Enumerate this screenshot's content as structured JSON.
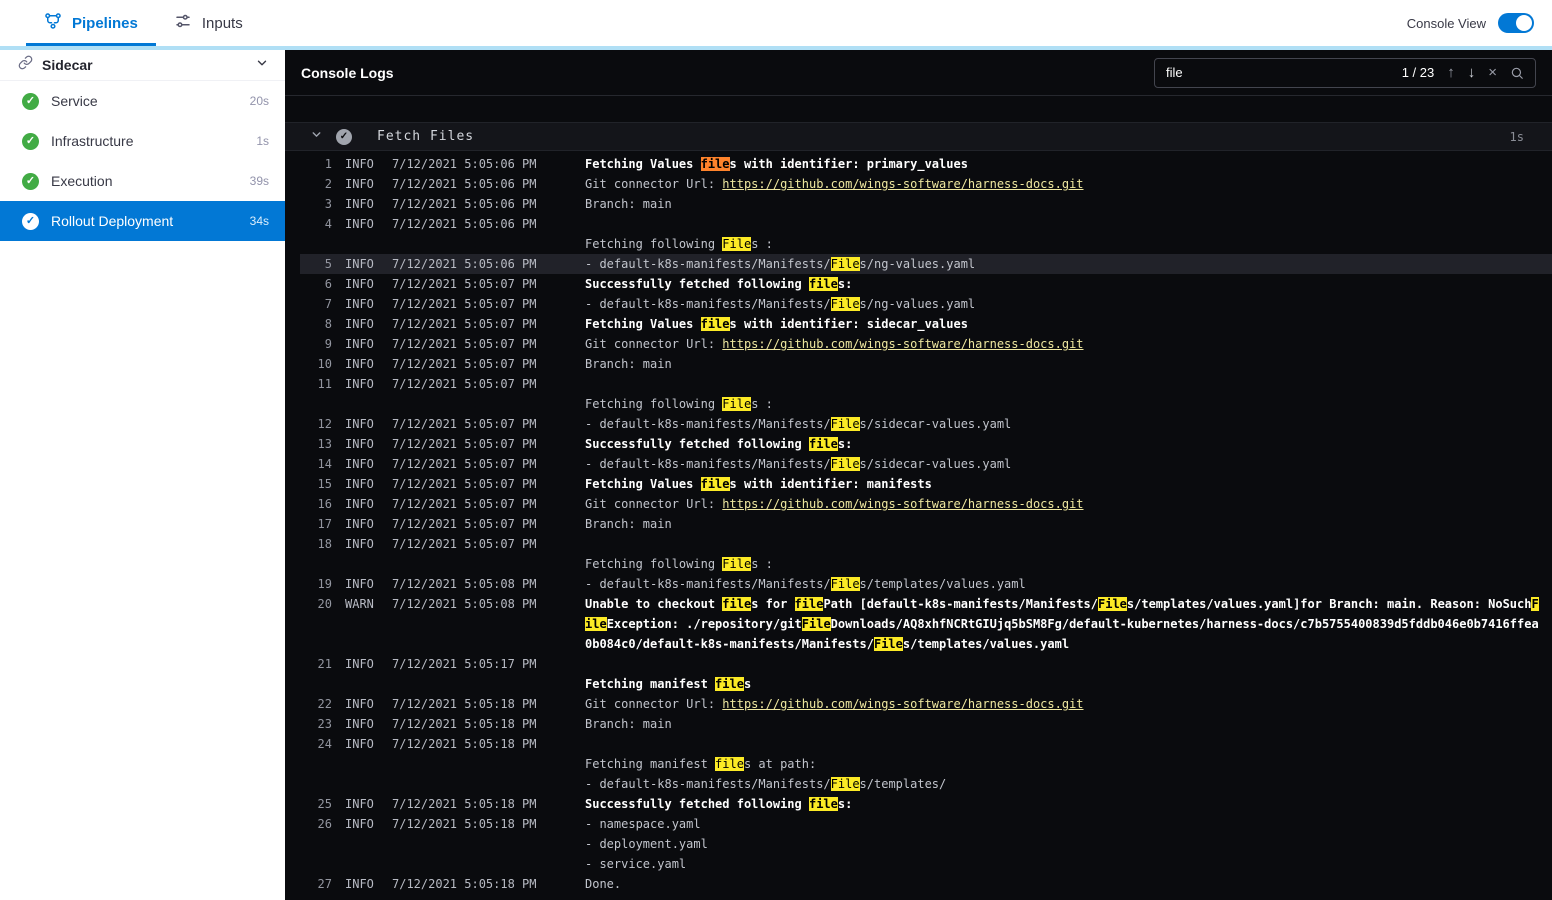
{
  "topbar": {
    "tabs": [
      {
        "label": "Pipelines"
      },
      {
        "label": "Inputs"
      }
    ],
    "console_view": {
      "label": "Console View",
      "on": true
    }
  },
  "sidebar": {
    "title": "Sidecar",
    "items": [
      {
        "label": "Service",
        "duration": "20s",
        "status": "success",
        "selected": false
      },
      {
        "label": "Infrastructure",
        "duration": "1s",
        "status": "success",
        "selected": false
      },
      {
        "label": "Execution",
        "duration": "39s",
        "status": "success",
        "selected": false
      },
      {
        "label": "Rollout Deployment",
        "duration": "34s",
        "status": "success",
        "selected": true
      }
    ]
  },
  "console": {
    "title": "Console Logs",
    "search": {
      "value": "file",
      "count": "1 / 23"
    },
    "section": {
      "title": "Fetch Files",
      "duration": "1s"
    },
    "colors": {
      "accent": "#0278d5",
      "highlight": "#fcea25",
      "current_match": "#ff832b",
      "success": "#42ab45",
      "topbar_divider": "#b0dff5"
    },
    "logs": [
      {
        "n": "1",
        "lvl": "INFO",
        "t": "7/12/2021 5:05:06 PM",
        "lines": [
          {
            "b": 1,
            "seg": [
              [
                "Fetching Values ",
                ""
              ],
              [
                "file",
                "c"
              ],
              [
                "s with identifier: primary_values",
                ""
              ]
            ]
          }
        ]
      },
      {
        "n": "2",
        "lvl": "INFO",
        "t": "7/12/2021 5:05:06 PM",
        "lines": [
          {
            "seg": [
              [
                "Git connector Url: ",
                ""
              ],
              [
                "https://github.com/wings-software/harness-docs.git",
                "u"
              ]
            ]
          }
        ]
      },
      {
        "n": "3",
        "lvl": "INFO",
        "t": "7/12/2021 5:05:06 PM",
        "lines": [
          {
            "seg": [
              [
                "Branch: main",
                ""
              ]
            ]
          }
        ]
      },
      {
        "n": "4",
        "lvl": "INFO",
        "t": "7/12/2021 5:05:06 PM",
        "lines": [
          {
            "seg": [
              [
                "",
                ""
              ]
            ]
          },
          {
            "seg": [
              [
                "Fetching following ",
                ""
              ],
              [
                "File",
                "h"
              ],
              [
                "s :",
                ""
              ]
            ]
          }
        ]
      },
      {
        "n": "5",
        "lvl": "INFO",
        "t": "7/12/2021 5:05:06 PM",
        "hl": 1,
        "lines": [
          {
            "seg": [
              [
                "- default-k8s-manifests/Manifests/",
                ""
              ],
              [
                "File",
                "h"
              ],
              [
                "s/ng-values.yaml",
                ""
              ]
            ]
          }
        ]
      },
      {
        "n": "6",
        "lvl": "INFO",
        "t": "7/12/2021 5:05:07 PM",
        "lines": [
          {
            "b": 1,
            "seg": [
              [
                "Successfully fetched following ",
                ""
              ],
              [
                "file",
                "h"
              ],
              [
                "s:",
                ""
              ]
            ]
          }
        ]
      },
      {
        "n": "7",
        "lvl": "INFO",
        "t": "7/12/2021 5:05:07 PM",
        "lines": [
          {
            "seg": [
              [
                "- default-k8s-manifests/Manifests/",
                ""
              ],
              [
                "File",
                "h"
              ],
              [
                "s/ng-values.yaml",
                ""
              ]
            ]
          }
        ]
      },
      {
        "n": "8",
        "lvl": "INFO",
        "t": "7/12/2021 5:05:07 PM",
        "lines": [
          {
            "b": 1,
            "seg": [
              [
                "Fetching Values ",
                ""
              ],
              [
                "file",
                "h"
              ],
              [
                "s with identifier: sidecar_values",
                ""
              ]
            ]
          }
        ]
      },
      {
        "n": "9",
        "lvl": "INFO",
        "t": "7/12/2021 5:05:07 PM",
        "lines": [
          {
            "seg": [
              [
                "Git connector Url: ",
                ""
              ],
              [
                "https://github.com/wings-software/harness-docs.git",
                "u"
              ]
            ]
          }
        ]
      },
      {
        "n": "10",
        "lvl": "INFO",
        "t": "7/12/2021 5:05:07 PM",
        "lines": [
          {
            "seg": [
              [
                "Branch: main",
                ""
              ]
            ]
          }
        ]
      },
      {
        "n": "11",
        "lvl": "INFO",
        "t": "7/12/2021 5:05:07 PM",
        "lines": [
          {
            "seg": [
              [
                "",
                ""
              ]
            ]
          },
          {
            "seg": [
              [
                "Fetching following ",
                ""
              ],
              [
                "File",
                "h"
              ],
              [
                "s :",
                ""
              ]
            ]
          }
        ]
      },
      {
        "n": "12",
        "lvl": "INFO",
        "t": "7/12/2021 5:05:07 PM",
        "lines": [
          {
            "seg": [
              [
                "- default-k8s-manifests/Manifests/",
                ""
              ],
              [
                "File",
                "h"
              ],
              [
                "s/sidecar-values.yaml",
                ""
              ]
            ]
          }
        ]
      },
      {
        "n": "13",
        "lvl": "INFO",
        "t": "7/12/2021 5:05:07 PM",
        "lines": [
          {
            "b": 1,
            "seg": [
              [
                "Successfully fetched following ",
                ""
              ],
              [
                "file",
                "h"
              ],
              [
                "s:",
                ""
              ]
            ]
          }
        ]
      },
      {
        "n": "14",
        "lvl": "INFO",
        "t": "7/12/2021 5:05:07 PM",
        "lines": [
          {
            "seg": [
              [
                "- default-k8s-manifests/Manifests/",
                ""
              ],
              [
                "File",
                "h"
              ],
              [
                "s/sidecar-values.yaml",
                ""
              ]
            ]
          }
        ]
      },
      {
        "n": "15",
        "lvl": "INFO",
        "t": "7/12/2021 5:05:07 PM",
        "lines": [
          {
            "b": 1,
            "seg": [
              [
                "Fetching Values ",
                ""
              ],
              [
                "file",
                "h"
              ],
              [
                "s with identifier: manifests",
                ""
              ]
            ]
          }
        ]
      },
      {
        "n": "16",
        "lvl": "INFO",
        "t": "7/12/2021 5:05:07 PM",
        "lines": [
          {
            "seg": [
              [
                "Git connector Url: ",
                ""
              ],
              [
                "https://github.com/wings-software/harness-docs.git",
                "u"
              ]
            ]
          }
        ]
      },
      {
        "n": "17",
        "lvl": "INFO",
        "t": "7/12/2021 5:05:07 PM",
        "lines": [
          {
            "seg": [
              [
                "Branch: main",
                ""
              ]
            ]
          }
        ]
      },
      {
        "n": "18",
        "lvl": "INFO",
        "t": "7/12/2021 5:05:07 PM",
        "lines": [
          {
            "seg": [
              [
                "",
                ""
              ]
            ]
          },
          {
            "seg": [
              [
                "Fetching following ",
                ""
              ],
              [
                "File",
                "h"
              ],
              [
                "s :",
                ""
              ]
            ]
          }
        ]
      },
      {
        "n": "19",
        "lvl": "INFO",
        "t": "7/12/2021 5:05:08 PM",
        "lines": [
          {
            "seg": [
              [
                "- default-k8s-manifests/Manifests/",
                ""
              ],
              [
                "File",
                "h"
              ],
              [
                "s/templates/values.yaml",
                ""
              ]
            ]
          }
        ]
      },
      {
        "n": "20",
        "lvl": "WARN",
        "t": "7/12/2021 5:05:08 PM",
        "lines": [
          {
            "b": 1,
            "seg": [
              [
                "Unable to checkout ",
                ""
              ],
              [
                "file",
                "h"
              ],
              [
                "s for ",
                ""
              ],
              [
                "file",
                "h"
              ],
              [
                "Path [default-k8s-manifests/Manifests/",
                ""
              ],
              [
                "File",
                "h"
              ],
              [
                "s/templates/values.yaml]for Branch: main. Reason: NoSuch",
                ""
              ],
              [
                "F",
                "h"
              ]
            ]
          },
          {
            "b": 1,
            "seg": [
              [
                "ile",
                "h"
              ],
              [
                "Exception: ./repository/git",
                ""
              ],
              [
                "File",
                "h"
              ],
              [
                "Downloads/AQ8xhfNCRtGIUjq5bSM8Fg/default-kubernetes/harness-docs/c7b5755400839d5fddb046e0b7416ffea",
                ""
              ]
            ]
          },
          {
            "b": 1,
            "seg": [
              [
                "0b084c0/default-k8s-manifests/Manifests/",
                ""
              ],
              [
                "File",
                "h"
              ],
              [
                "s/templates/values.yaml",
                ""
              ]
            ]
          }
        ]
      },
      {
        "n": "21",
        "lvl": "INFO",
        "t": "7/12/2021 5:05:17 PM",
        "lines": [
          {
            "seg": [
              [
                "",
                ""
              ]
            ]
          },
          {
            "b": 1,
            "seg": [
              [
                "Fetching manifest ",
                ""
              ],
              [
                "file",
                "h"
              ],
              [
                "s",
                ""
              ]
            ]
          }
        ]
      },
      {
        "n": "22",
        "lvl": "INFO",
        "t": "7/12/2021 5:05:18 PM",
        "lines": [
          {
            "seg": [
              [
                "Git connector Url: ",
                ""
              ],
              [
                "https://github.com/wings-software/harness-docs.git",
                "u"
              ]
            ]
          }
        ]
      },
      {
        "n": "23",
        "lvl": "INFO",
        "t": "7/12/2021 5:05:18 PM",
        "lines": [
          {
            "seg": [
              [
                "Branch: main",
                ""
              ]
            ]
          }
        ]
      },
      {
        "n": "24",
        "lvl": "INFO",
        "t": "7/12/2021 5:05:18 PM",
        "lines": [
          {
            "seg": [
              [
                "",
                ""
              ]
            ]
          },
          {
            "seg": [
              [
                "Fetching manifest ",
                ""
              ],
              [
                "file",
                "h"
              ],
              [
                "s at path:",
                ""
              ]
            ]
          },
          {
            "seg": [
              [
                "- default-k8s-manifests/Manifests/",
                ""
              ],
              [
                "File",
                "h"
              ],
              [
                "s/templates/",
                ""
              ]
            ]
          }
        ]
      },
      {
        "n": "25",
        "lvl": "INFO",
        "t": "7/12/2021 5:05:18 PM",
        "lines": [
          {
            "b": 1,
            "seg": [
              [
                "Successfully fetched following ",
                ""
              ],
              [
                "file",
                "h"
              ],
              [
                "s:",
                ""
              ]
            ]
          }
        ]
      },
      {
        "n": "26",
        "lvl": "INFO",
        "t": "7/12/2021 5:05:18 PM",
        "lines": [
          {
            "seg": [
              [
                "- namespace.yaml",
                ""
              ]
            ]
          },
          {
            "seg": [
              [
                "- deployment.yaml",
                ""
              ]
            ]
          },
          {
            "seg": [
              [
                "- service.yaml",
                ""
              ]
            ]
          }
        ]
      },
      {
        "n": "27",
        "lvl": "INFO",
        "t": "7/12/2021 5:05:18 PM",
        "lines": [
          {
            "seg": [
              [
                "Done.",
                ""
              ]
            ]
          }
        ]
      }
    ]
  }
}
